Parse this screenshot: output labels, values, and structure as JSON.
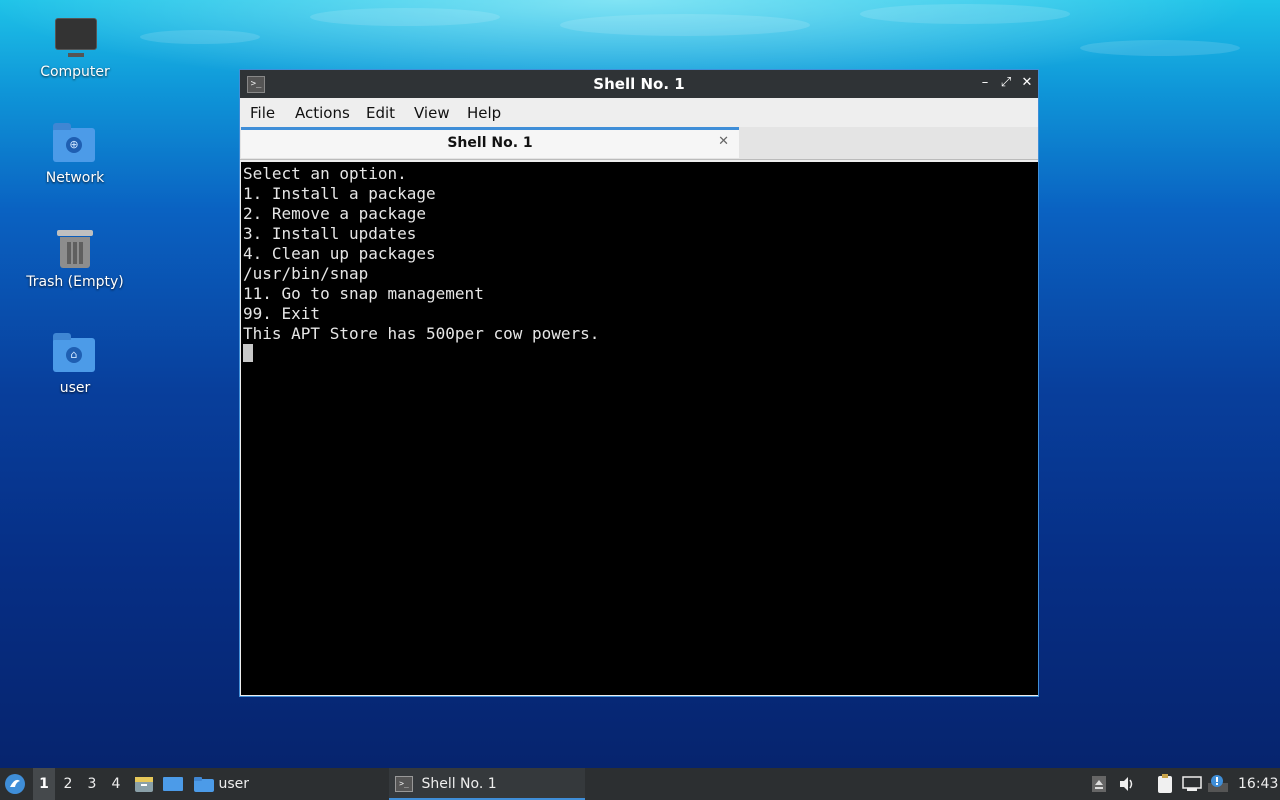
{
  "desktop": {
    "icons": [
      {
        "label": "Computer",
        "icon": "computer-icon"
      },
      {
        "label": "Network",
        "icon": "network-folder-icon"
      },
      {
        "label": "Trash (Empty)",
        "icon": "trash-icon"
      },
      {
        "label": "user",
        "icon": "home-folder-icon"
      }
    ]
  },
  "window": {
    "title": "Shell No. 1",
    "controls": {
      "minimize": "–",
      "maximize": "⤢",
      "close": "✕"
    },
    "menu": [
      "File",
      "Actions",
      "Edit",
      "View",
      "Help"
    ],
    "tab": {
      "label": "Shell No. 1",
      "close": "✕"
    },
    "terminal_lines": [
      "Select an option.",
      "1. Install a package",
      "2. Remove a package",
      "3. Install updates",
      "4. Clean up packages",
      "/usr/bin/snap",
      "11. Go to snap management",
      "99. Exit",
      "This APT Store has 500per cow powers."
    ]
  },
  "taskbar": {
    "workspaces": [
      "1",
      "2",
      "3",
      "4"
    ],
    "active_workspace": "1",
    "launchers": [
      "file-manager-icon",
      "show-desktop-icon"
    ],
    "folder_task": "user",
    "task": "Shell No. 1",
    "tray": [
      "eject-icon",
      "volume-icon",
      "clipboard-icon",
      "network-icon",
      "update-notifier-icon"
    ],
    "clock": "16:43"
  },
  "colors": {
    "accent": "#3f8ed8",
    "titlebar": "#2f3336",
    "terminal_bg": "#000000",
    "terminal_fg": "#e6e6e6",
    "taskbar": "#2c2f31"
  }
}
